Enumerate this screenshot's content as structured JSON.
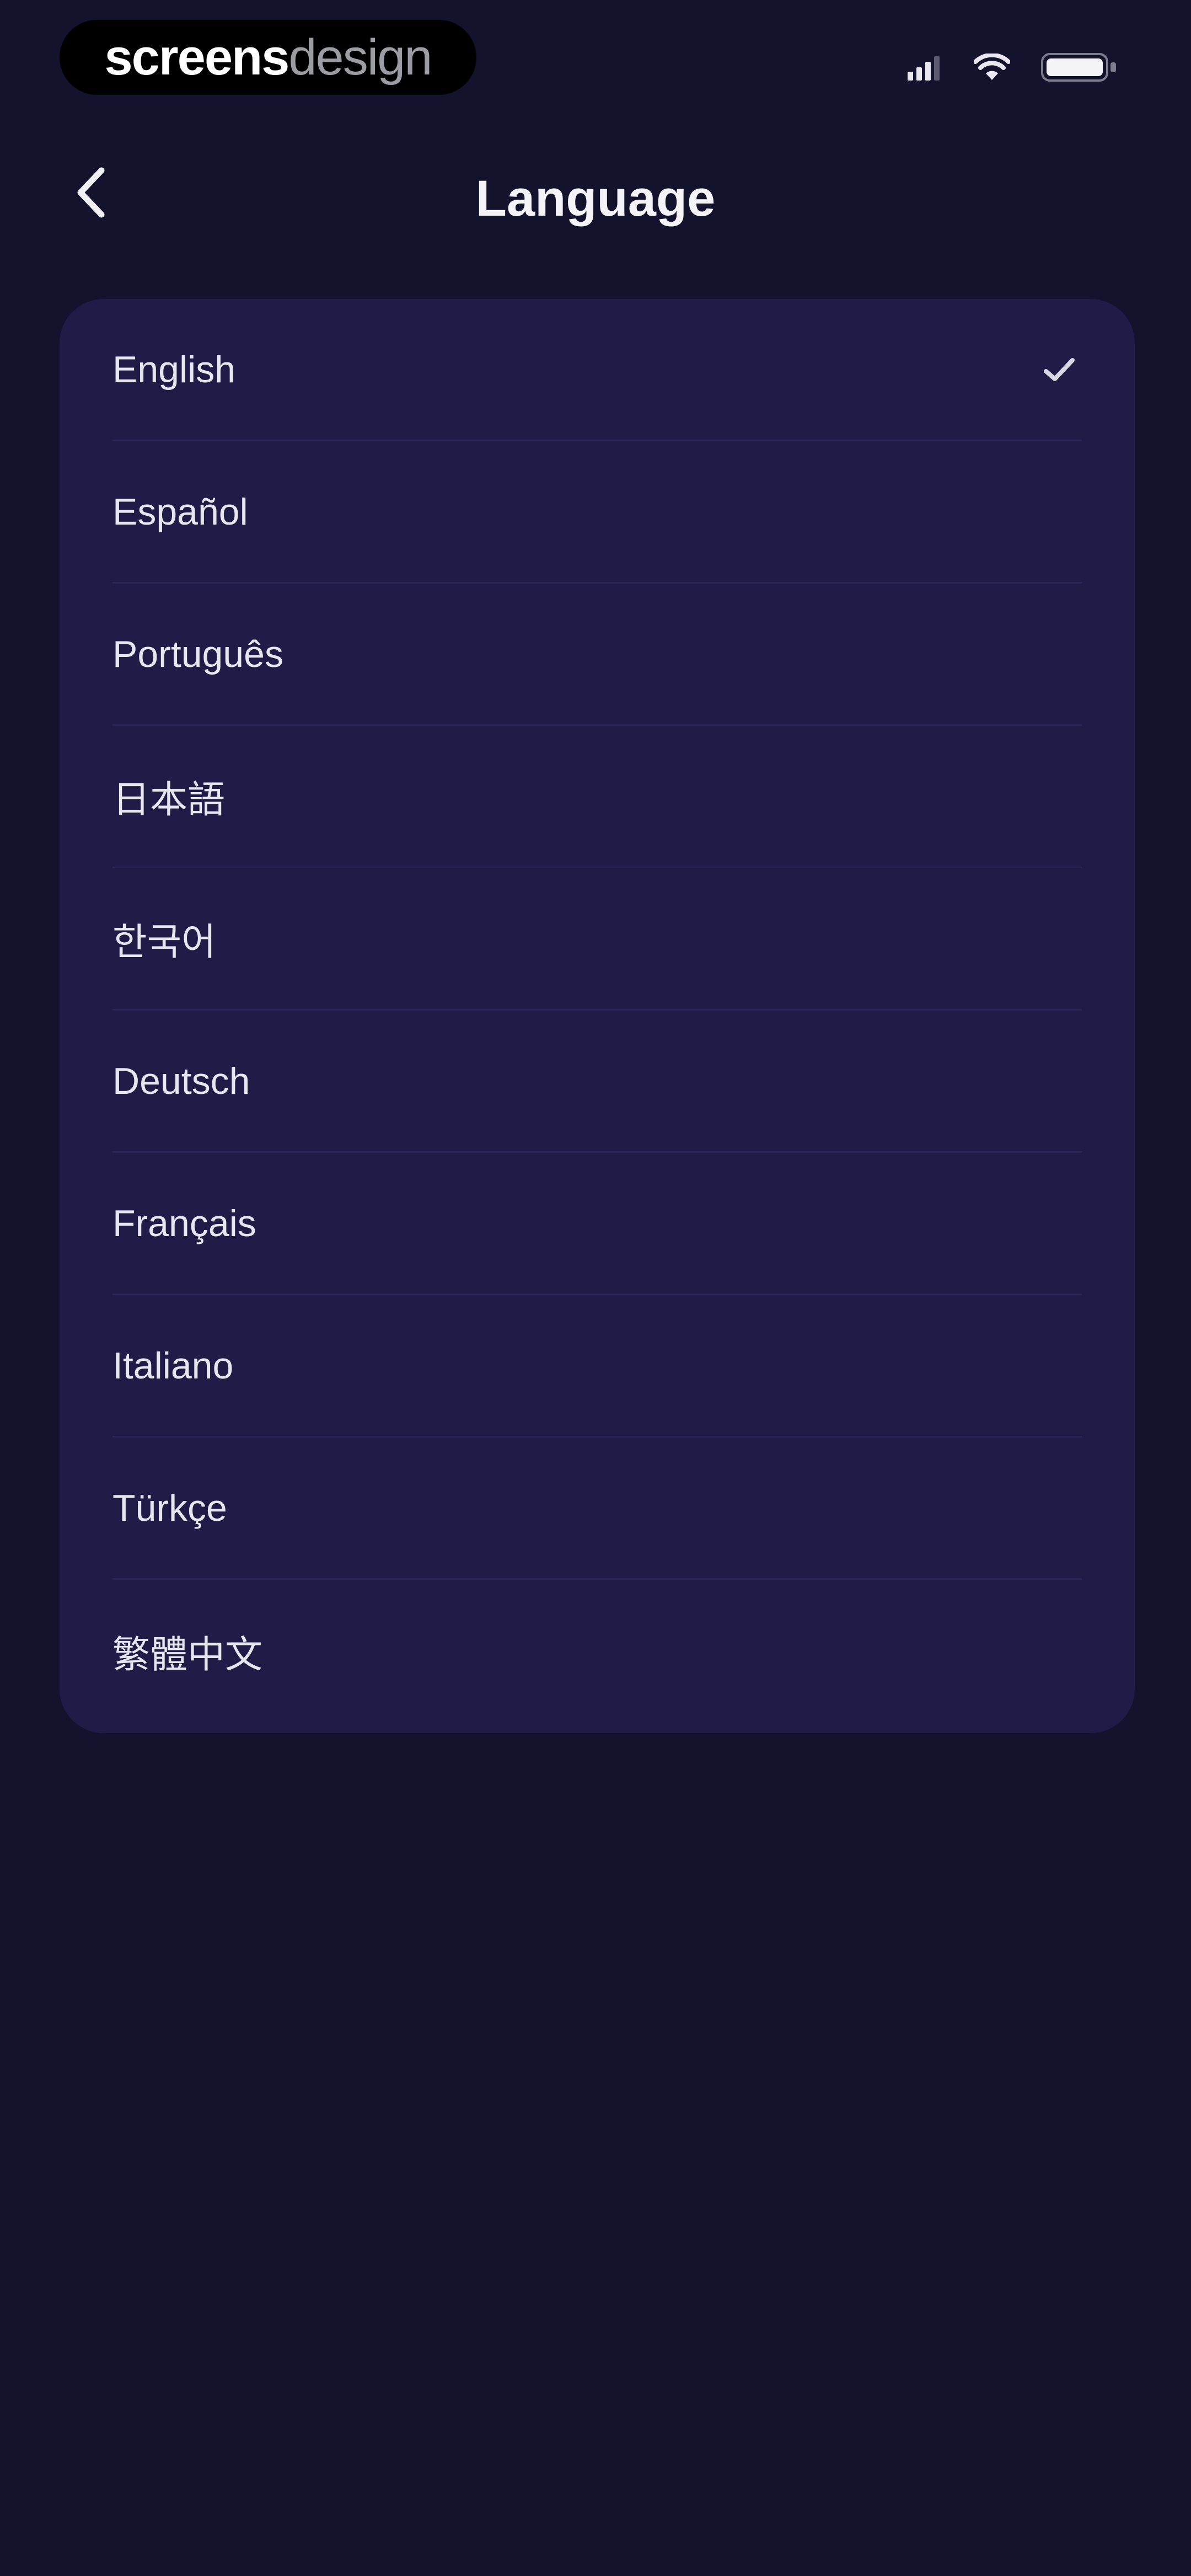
{
  "status_bar": {
    "watermark_bold": "screens",
    "watermark_light": "design",
    "icons": [
      "signal-icon",
      "wifi-icon",
      "battery-icon"
    ]
  },
  "header": {
    "title": "Language",
    "back_icon": "chevron-left-icon"
  },
  "languages": {
    "items": [
      {
        "label": "English",
        "selected": true
      },
      {
        "label": "Español",
        "selected": false
      },
      {
        "label": "Português",
        "selected": false
      },
      {
        "label": "日本語",
        "selected": false
      },
      {
        "label": "한국어",
        "selected": false
      },
      {
        "label": "Deutsch",
        "selected": false
      },
      {
        "label": "Français",
        "selected": false
      },
      {
        "label": "Italiano",
        "selected": false
      },
      {
        "label": "Türkçe",
        "selected": false
      },
      {
        "label": "繁體中文",
        "selected": false
      }
    ],
    "check_icon": "checkmark-icon"
  },
  "colors": {
    "background": "#14132d",
    "card": "#1f1d48",
    "divider": "#29275a",
    "text": "#e6e6ef"
  }
}
